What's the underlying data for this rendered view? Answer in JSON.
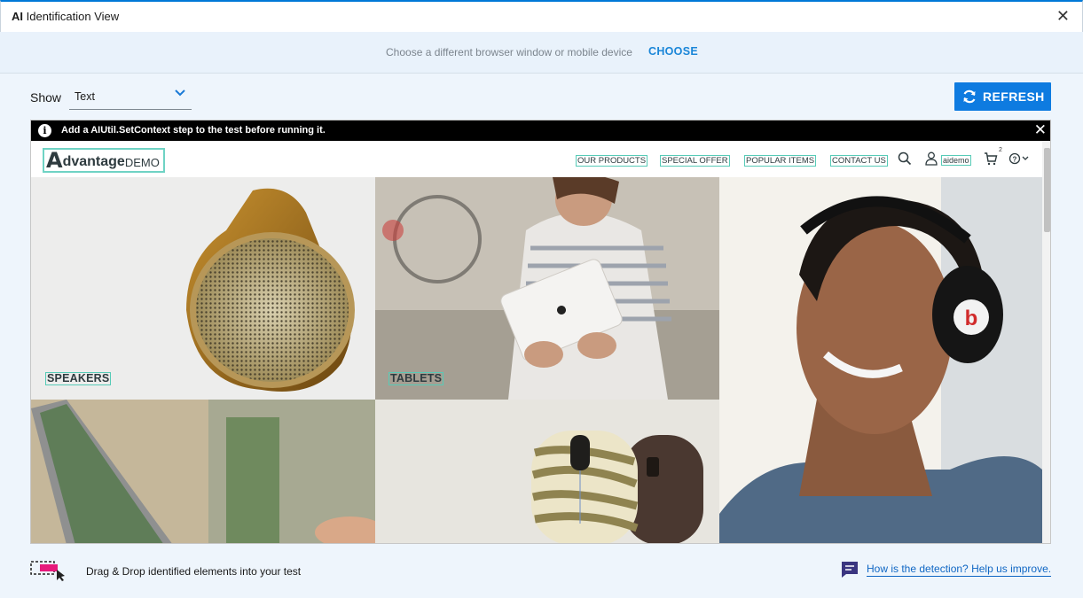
{
  "window": {
    "title_bold": "AI",
    "title_rest": "Identification View",
    "close_glyph": "✕"
  },
  "choose_bar": {
    "message": "Choose a different browser window or mobile device",
    "choose_label": "CHOOSE"
  },
  "show": {
    "label": "Show",
    "selected": "Text"
  },
  "refresh_label": "REFRESH",
  "notice": {
    "text": "Add a AIUtil.SetContext step to the test before running it.",
    "close_glyph": "✕"
  },
  "site": {
    "logo": {
      "a": "A",
      "rest": "dvantage",
      "demo": "DEMO"
    },
    "nav": [
      "OUR PRODUCTS",
      "SPECIAL OFFER",
      "POPULAR ITEMS",
      "CONTACT US"
    ],
    "user": "aidemo",
    "cart_count": "2",
    "tiles": {
      "speakers": "SPEAKERS",
      "tablets": "TABLETS"
    }
  },
  "footer": {
    "drag_text": "Drag & Drop identified elements into your test",
    "help_link": "How is the detection? Help us improve."
  },
  "colors": {
    "accent": "#0e7be0",
    "highlight": "#57cbb7",
    "notice_bg": "#000000"
  }
}
